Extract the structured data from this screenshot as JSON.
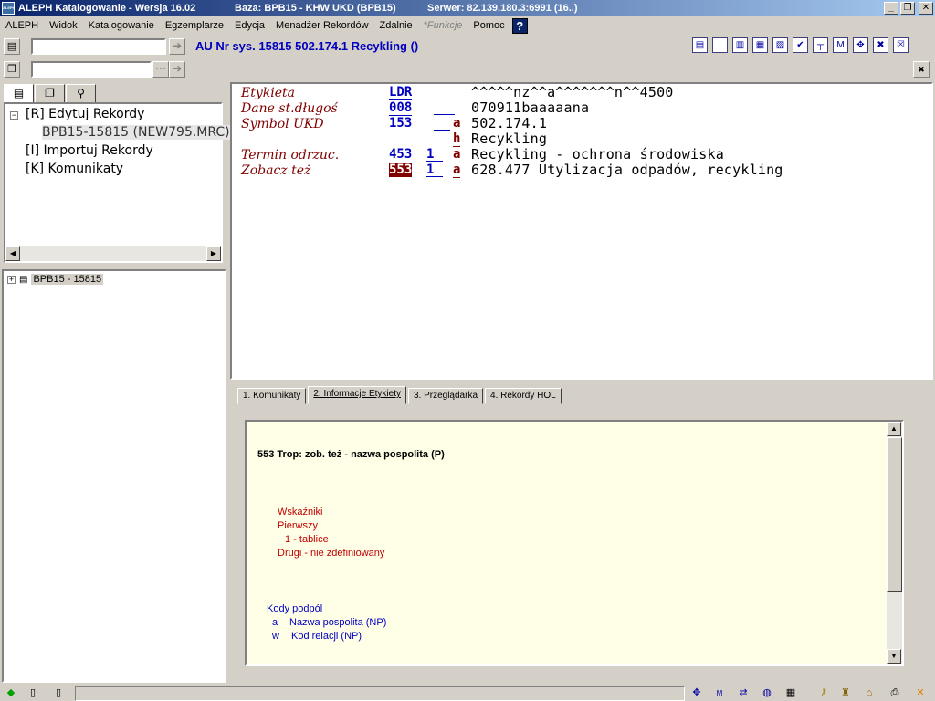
{
  "window": {
    "title_app": "ALEPH Katalogowanie - Wersja 16.02",
    "title_base": "Baza:  BPB15 - KHW UKD (BPB15)",
    "title_server": "Serwer:  82.139.180.3:6991 (16..)",
    "app_icon_text": "ALEPH"
  },
  "menu": {
    "items": [
      "ALEPH",
      "Widok",
      "Katalogowanie",
      "Egzemplarze",
      "Edycja",
      "Menadżer Rekordów",
      "Zdalnie"
    ],
    "disabled_item": "*Funkcje",
    "help_item": "Pomoc",
    "help_icon": "?"
  },
  "toolbar": {
    "record_title": "AU Nr sys. 15815 502.174.1 Recykling ()",
    "search_value": "",
    "second_value": "",
    "tool_icons": [
      "▤",
      "⋮",
      "▥",
      "▦",
      "▧",
      "✔",
      "┬",
      "M",
      "✥",
      "✖",
      "☒"
    ]
  },
  "tree": {
    "nodes": [
      {
        "label": "[R] Edytuj Rekordy",
        "expander": "−"
      },
      {
        "label": "BPB15-15815 (NEW795.MRC)"
      },
      {
        "label": "[I] Importuj Rekordy"
      },
      {
        "label": "[K] Komunikaty"
      }
    ],
    "bottom_node": "BPB15 - 15815"
  },
  "record": {
    "rows": [
      {
        "label": "Etykieta",
        "tag": "LDR",
        "ind1": "",
        "ind2": "",
        "code": "",
        "value": "^^^^^nz^^a^^^^^^^n^^4500"
      },
      {
        "label": "Dane st.długoś",
        "tag": "008",
        "ind1": "",
        "ind2": "",
        "code": "",
        "value": "070911baaaaana"
      },
      {
        "label": "Symbol UKD",
        "tag": "153",
        "ind1": "",
        "ind2": "",
        "code": "a",
        "value": "502.174.1"
      },
      {
        "label": "",
        "tag": "",
        "ind1": "",
        "ind2": "",
        "code": "h",
        "value": "Recykling"
      },
      {
        "label": "Termin odrzuc.",
        "tag": "453",
        "ind1": "1",
        "ind2": "",
        "code": "a",
        "value": "Recykling - ochrona środowiska"
      },
      {
        "label": "Zobacz też",
        "tag": "553",
        "ind1": "1",
        "ind2": "",
        "code": "a",
        "value": "628.477 Utylizacja odpadów, recykling"
      }
    ]
  },
  "bottom_tabs": [
    {
      "label": "1. Komunikaty"
    },
    {
      "label": "2. Informacje Etykiety"
    },
    {
      "label": "3. Przeglądarka"
    },
    {
      "label": "4. Rekordy HOL"
    }
  ],
  "tag_info": {
    "title": "553 Trop: zob. też - nazwa pospolita  (P)",
    "indicators_header": "Wskaźniki",
    "first": "Pierwszy",
    "first_value": "1 - tablice",
    "second": "Drugi - nie zdefiniowany",
    "subfields_header": "Kody podpól",
    "sub_a_code": "a",
    "sub_a_label": "Nazwa pospolita  (NP)",
    "sub_w_code": "w",
    "sub_w_label": "Kod relacji (NP)"
  },
  "colors": {
    "title_bar_start": "#0a246a",
    "title_bar_end": "#a6caf0",
    "field_label": "#800000",
    "tag_blue": "#0000c0",
    "highlight": "#800000",
    "info_bg": "#ffffe8"
  }
}
